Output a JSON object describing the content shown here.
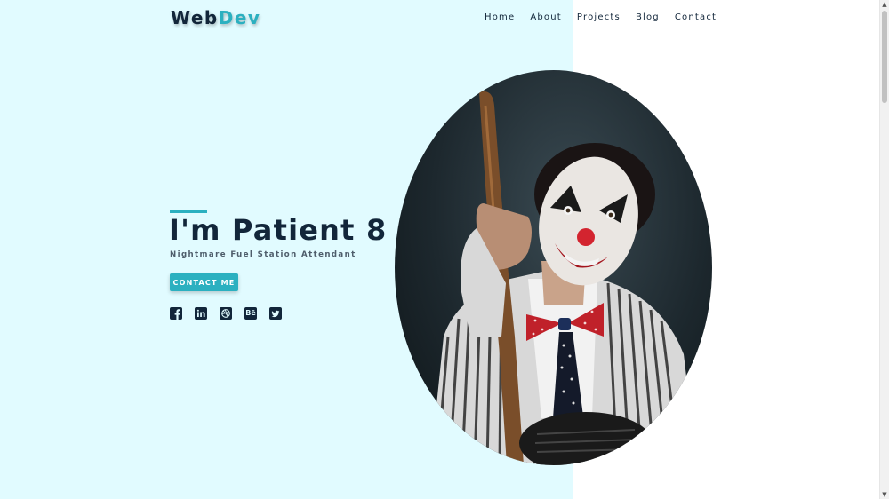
{
  "brand": {
    "part1": "Web",
    "part2": "Dev"
  },
  "nav": [
    "Home",
    "About",
    "Projects",
    "Blog",
    "Contact"
  ],
  "hero": {
    "title": "I'm Patient 8",
    "subtitle": "Nightmare Fuel Station Attendant",
    "cta_label": "CONTACT ME"
  },
  "socials": [
    "facebook-icon",
    "linkedin-icon",
    "dribbble-icon",
    "behance-icon",
    "twitter-icon"
  ],
  "social_labels": {
    "behance": "Bē"
  },
  "colors": {
    "accent": "#2bb0c0",
    "navy": "#12263a",
    "hero_bg": "#e1fbff"
  }
}
